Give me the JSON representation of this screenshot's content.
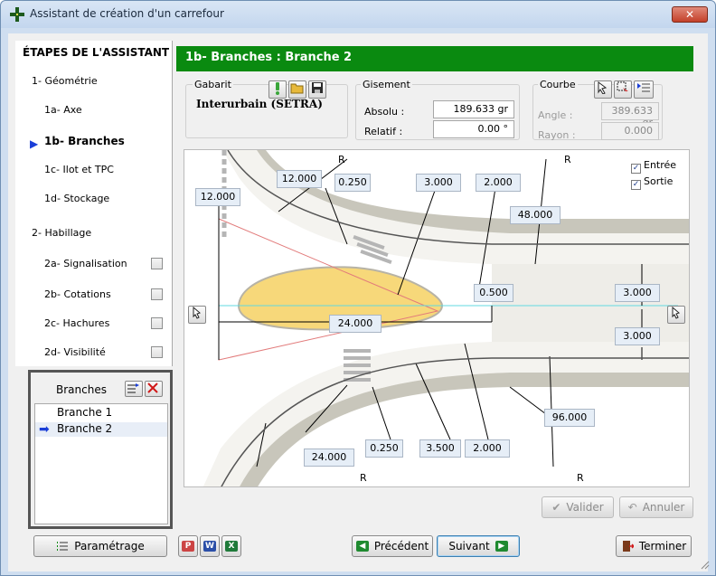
{
  "window": {
    "title": "Assistant de création d'un carrefour",
    "close_label": "✕"
  },
  "steps": {
    "title": "ÉTAPES DE L'ASSISTANT",
    "items": [
      {
        "label": "1- Géométrie"
      },
      {
        "label": "1a- Axe"
      },
      {
        "label": "1b- Branches"
      },
      {
        "label": "1c- Ilot et TPC"
      },
      {
        "label": "1d- Stockage"
      },
      {
        "label": "2- Habillage"
      },
      {
        "label": "2a- Signalisation"
      },
      {
        "label": "2b- Cotations"
      },
      {
        "label": "2c- Hachures"
      },
      {
        "label": "2d- Visibilité"
      }
    ],
    "active_arrow": "▶"
  },
  "branches": {
    "header": "Branches",
    "items": [
      "Branche 1",
      "Branche 2"
    ],
    "selected_arrow": "➡"
  },
  "main": {
    "header": "1b- Branches : Branche 2",
    "gabarit": {
      "label": "Gabarit",
      "value": "Interurbain (SETRA)"
    },
    "gisement": {
      "label": "Gisement",
      "absolu_label": "Absolu :",
      "absolu_value": "189.633 gr",
      "relatif_label": "Relatif :",
      "relatif_value": "0.00 °"
    },
    "courbe": {
      "label": "Courbe",
      "angle_label": "Angle :",
      "angle_value": "389.633 gr",
      "rayon_label": "Rayon :",
      "rayon_value": "0.000"
    }
  },
  "drawing": {
    "dims": {
      "d_12_top": "12.000",
      "d_12_left": "12.000",
      "d_0250_top": "0.250",
      "d_3000_top": "3.000",
      "d_2000_top": "2.000",
      "d_48": "48.000",
      "d_0500": "0.500",
      "d_3000_right1": "3.000",
      "d_3000_right2": "3.000",
      "d_24_mid": "24.000",
      "d_96": "96.000",
      "d_24_bot": "24.000",
      "d_0250_bot": "0.250",
      "d_3500_bot": "3.500",
      "d_2000_bot": "2.000"
    },
    "r_label": "R",
    "entree_label": "Entrée",
    "sortie_label": "Sortie",
    "check_mark": "✓"
  },
  "buttons": {
    "valider": "Valider",
    "annuler": "Annuler",
    "parametrage": "Paramétrage",
    "precedent": "Précédent",
    "suivant": "Suivant",
    "terminer": "Terminer"
  },
  "colors": {
    "header_green": "#0a8a10",
    "island_fill": "#f7d87a",
    "road_grey": "#c8c6bb"
  }
}
